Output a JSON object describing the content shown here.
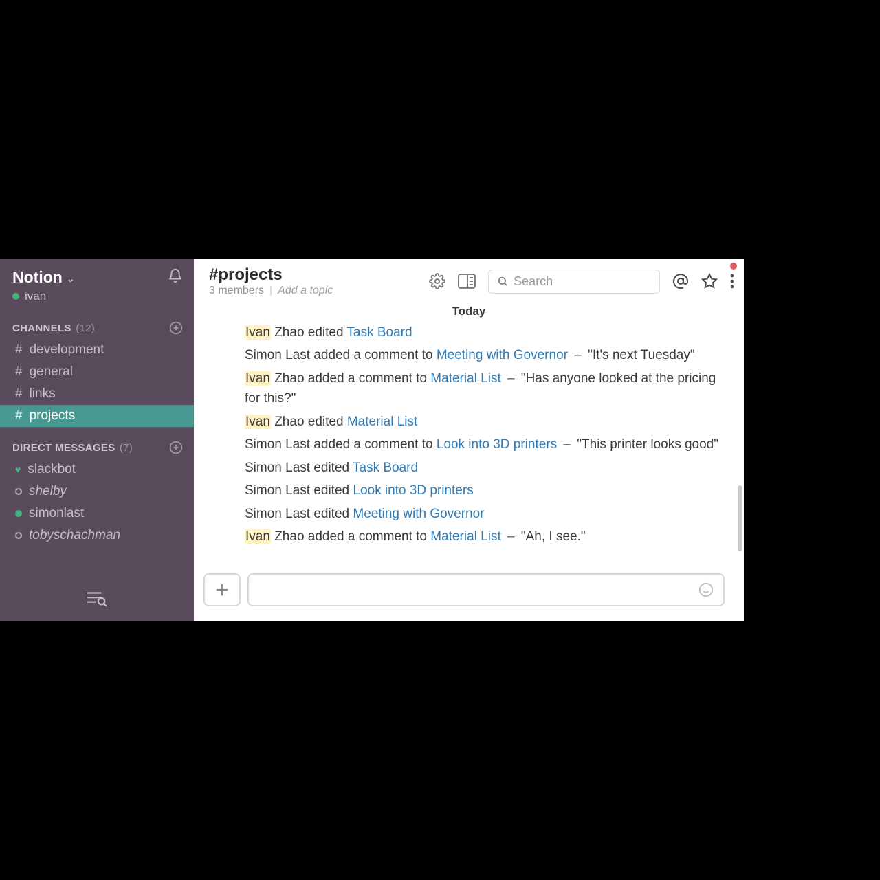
{
  "workspace": {
    "name": "Notion",
    "me": "ivan"
  },
  "sidebar": {
    "channels_label": "CHANNELS",
    "channels_count": "(12)",
    "channels": [
      {
        "name": "development",
        "active": false
      },
      {
        "name": "general",
        "active": false
      },
      {
        "name": "links",
        "active": false
      },
      {
        "name": "projects",
        "active": true
      }
    ],
    "dms_label": "DIRECT MESSAGES",
    "dms_count": "(7)",
    "dms": [
      {
        "name": "slackbot",
        "presence": "heart",
        "italic": false
      },
      {
        "name": "shelby",
        "presence": "idle",
        "italic": true
      },
      {
        "name": "simonlast",
        "presence": "online",
        "italic": false
      },
      {
        "name": "tobyschachman",
        "presence": "idle",
        "italic": true
      }
    ]
  },
  "header": {
    "channel": "#projects",
    "members": "3 members",
    "topic_placeholder": "Add a topic",
    "search_placeholder": "Search"
  },
  "date_separator": "Today",
  "highlight_token": "Ivan",
  "link_color": "#2f7bb5",
  "accent_color": "#489992",
  "feed": [
    {
      "hl": true,
      "who": "Ivan Zhao",
      "verb": "edited",
      "target": "Task Board",
      "quote": null
    },
    {
      "hl": false,
      "who": "Simon Last",
      "verb": "added a comment to",
      "target": "Meeting with Governor",
      "quote": "\"It's next Tuesday\""
    },
    {
      "hl": true,
      "who": "Ivan Zhao",
      "verb": "added a comment to",
      "target": "Material List",
      "quote": "\"Has anyone looked at the pricing for this?\""
    },
    {
      "hl": true,
      "who": "Ivan Zhao",
      "verb": "edited",
      "target": "Material List",
      "quote": null
    },
    {
      "hl": false,
      "who": "Simon Last",
      "verb": "added a comment to",
      "target": "Look into 3D printers",
      "quote": "\"This printer looks good\""
    },
    {
      "hl": false,
      "who": "Simon Last",
      "verb": "edited",
      "target": "Task Board",
      "quote": null
    },
    {
      "hl": false,
      "who": "Simon Last",
      "verb": "edited",
      "target": "Look into 3D printers",
      "quote": null
    },
    {
      "hl": false,
      "who": "Simon Last",
      "verb": "edited",
      "target": "Meeting with Governor",
      "quote": null
    },
    {
      "hl": true,
      "who": "Ivan Zhao",
      "verb": "added a comment to",
      "target": "Material List",
      "quote": "\"Ah, I see.\""
    }
  ]
}
